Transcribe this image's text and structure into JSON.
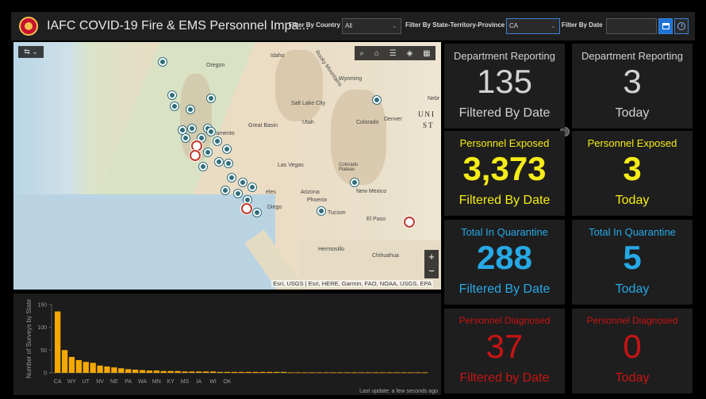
{
  "header": {
    "title": "IAFC COVID-19 Fire & EMS Personnel Impa...",
    "filter_country_label": "Filter By Country",
    "filter_country_value": "All",
    "filter_state_label": "Filter By State-Territory-Province",
    "filter_state_value": "CA",
    "filter_date_label": "Filter By Date",
    "filter_date_value": ""
  },
  "map": {
    "labels": {
      "oregon": "Oregon",
      "idaho": "Idaho",
      "wyoming": "Wyoming",
      "nebraska": "Nebr",
      "rocky": "Rocky Mountains",
      "slc": "Salt Lake City",
      "denver": "Denver",
      "united": "UNI",
      "states": "ST",
      "colorado": "Colorado",
      "utah": "Utah",
      "sacramento": "ramento",
      "greatbasin": "Great Basin",
      "lasvegas": "Las Vegas",
      "plateau": "Colorado Plateau",
      "angeles": "eles",
      "diego": "Diego",
      "arizona": "Arizona",
      "phoenix": "Phoenix",
      "newmexico": "New Mexico",
      "tucson": "Tucson",
      "elpaso": "El Paso",
      "hermosillo": "Hermosillo",
      "chihuahua": "Chihuahua"
    },
    "attribution": "Esri, USGS | Esri, HERE, Garmin, FAO, NOAA, USGS, EPA",
    "zoom_in": "+",
    "zoom_out": "−"
  },
  "cards": {
    "dept_filtered": {
      "label": "Department Reporting",
      "value": "135",
      "sub": "Filtered By Date"
    },
    "dept_today": {
      "label": "Department Reporting",
      "value": "3",
      "sub": "Today"
    },
    "exposed_filtered": {
      "label": "Personnel Exposed",
      "value": "3,373",
      "sub": "Filtered By Date"
    },
    "exposed_today": {
      "label": "Personnel Exposed",
      "value": "3",
      "sub": "Today"
    },
    "quarantine_filtered": {
      "label": "Total In Quarantine",
      "value": "288",
      "sub": "Filtered By Date"
    },
    "quarantine_today": {
      "label": "Total In Quarantine",
      "value": "5",
      "sub": "Today"
    },
    "diagnosed_filtered": {
      "label": "Personnel Diagnosed",
      "value": "37",
      "sub": "Filtered by Date"
    },
    "diagnosed_today": {
      "label": "Personnel Diagnosed",
      "value": "0",
      "sub": "Today"
    }
  },
  "colors": {
    "grey": "#d2d2d2",
    "yellow": "#f5ec18",
    "blue": "#27a9e6",
    "red": "#c81414",
    "bar": "#f5a800"
  },
  "chart_data": {
    "type": "bar",
    "ylabel": "Number of Surveys by State",
    "ylim": [
      0,
      150
    ],
    "yticks": [
      0,
      50,
      100,
      150
    ],
    "tick_labels": [
      "CA",
      "WY",
      "UT",
      "NV",
      "NE",
      "PA",
      "WA",
      "MN",
      "KY",
      "MS",
      "IA",
      "WI",
      "OK"
    ],
    "values": [
      135,
      50,
      35,
      28,
      24,
      22,
      16,
      14,
      12,
      10,
      8,
      7,
      6,
      5,
      5,
      4,
      4,
      4,
      3,
      3,
      3,
      3,
      3,
      2,
      2,
      2,
      2,
      2,
      2,
      2,
      2,
      2,
      2,
      1,
      1,
      1,
      1,
      1,
      1,
      1,
      1,
      1,
      1,
      1,
      1,
      1,
      1,
      1,
      1,
      1,
      1,
      1,
      1
    ]
  },
  "footer": {
    "last_update": "Last update: a few seconds ago"
  }
}
